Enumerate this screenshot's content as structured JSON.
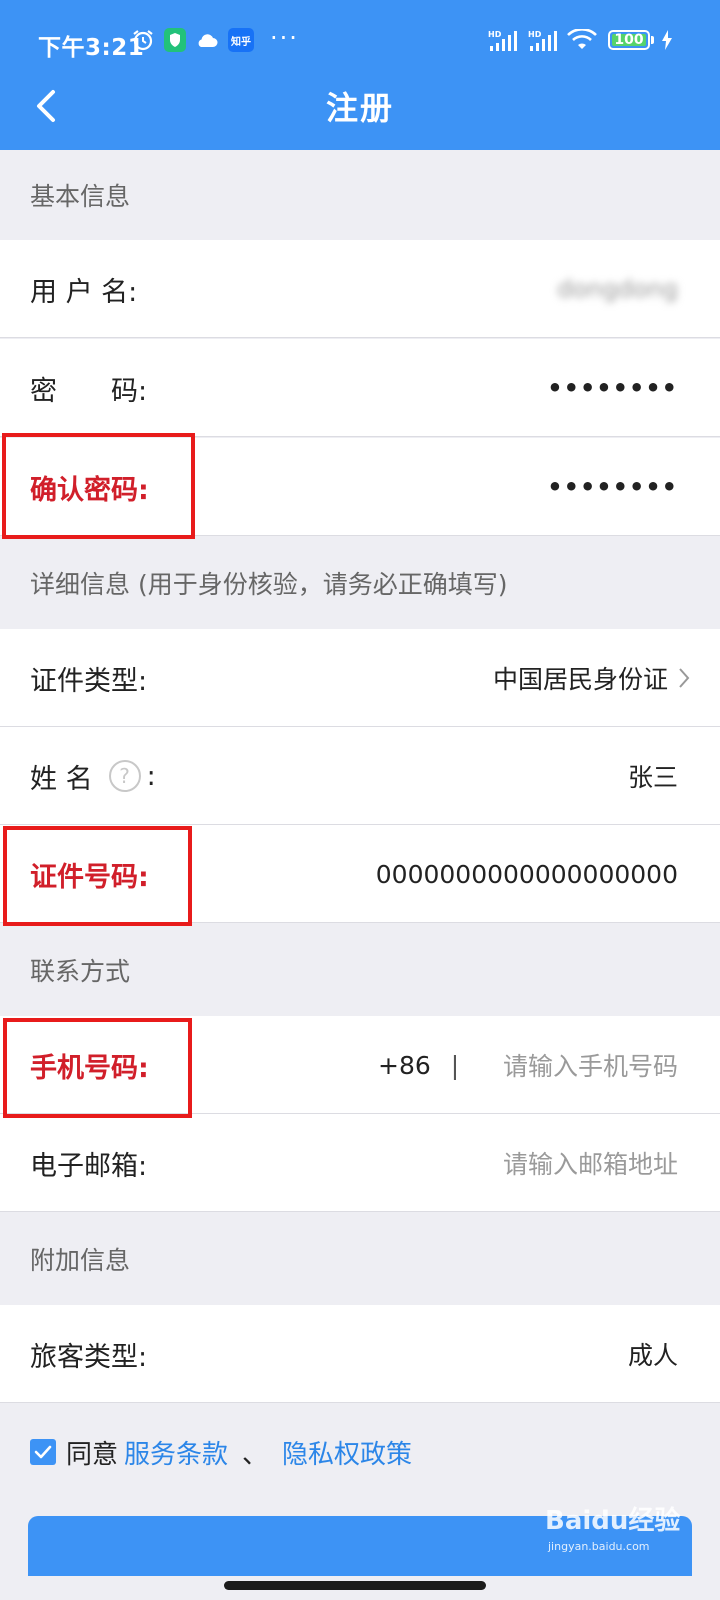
{
  "status_bar": {
    "time": "下午3:21",
    "zhihu_label": "知乎",
    "more": "···",
    "signal_label": "HD",
    "battery": "100"
  },
  "nav": {
    "title": "注册"
  },
  "sections": {
    "basic": "基本信息",
    "detail": "详细信息 (用于身份核验，请务必正确填写)",
    "contact": "联系方式",
    "extra": "附加信息"
  },
  "fields": {
    "username": {
      "label": "用 户 名:",
      "value": "dongdong"
    },
    "password": {
      "label": "密　　码:",
      "value": "••••••••"
    },
    "confirm_password": {
      "label": "确认密码:",
      "value": "••••••••"
    },
    "id_type": {
      "label": "证件类型:",
      "value": "中国居民身份证"
    },
    "name": {
      "label_prefix": "姓 名",
      "help": "?",
      "label_suffix": ":",
      "value": "张三"
    },
    "id_number": {
      "label": "证件号码:",
      "value": "0000000000000000000"
    },
    "phone": {
      "label": "手机号码:",
      "prefix": "+86",
      "separator": "|",
      "placeholder": "请输入手机号码"
    },
    "email": {
      "label": "电子邮箱:",
      "placeholder": "请输入邮箱地址"
    },
    "passenger_type": {
      "label": "旅客类型:",
      "value": "成人"
    }
  },
  "agreement": {
    "checked": true,
    "text": "同意",
    "terms": "服务条款",
    "separator": "、",
    "privacy": "隐私权政策"
  },
  "watermark": {
    "brand": "Baidu经验",
    "sub": "jingyan.baidu.com"
  },
  "colors": {
    "primary": "#3d93f5",
    "highlight": "#e81b1b",
    "link": "#2c86e8"
  }
}
